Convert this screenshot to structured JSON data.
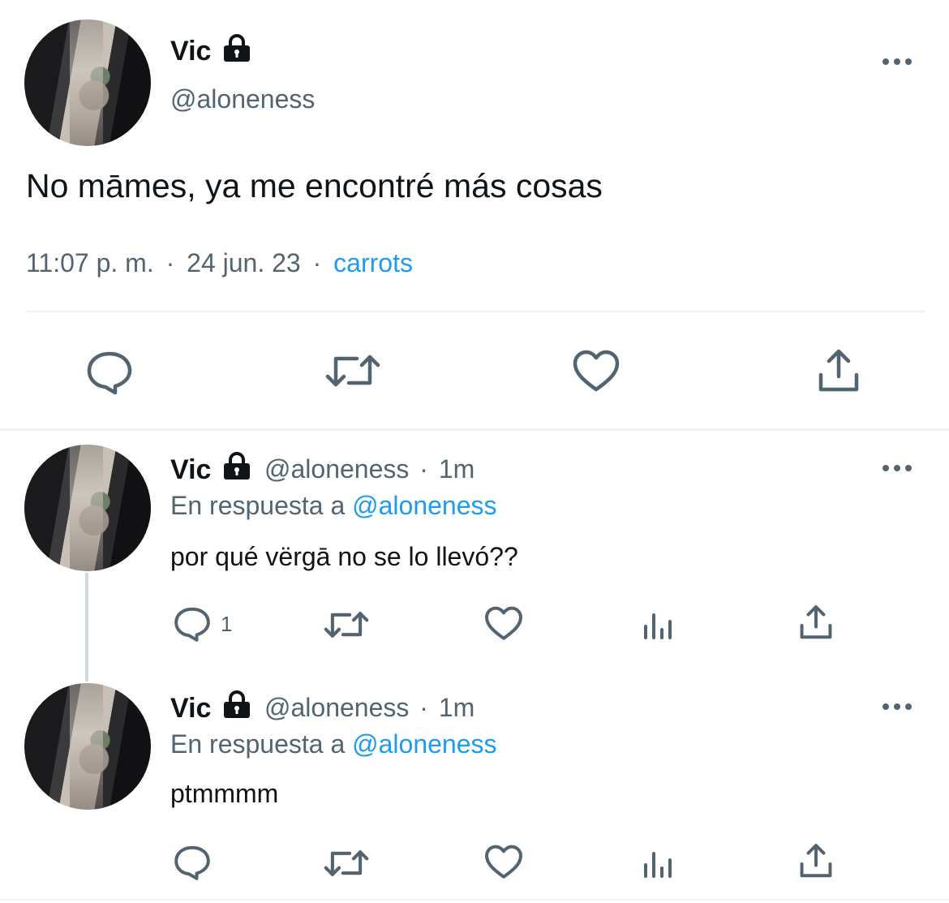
{
  "main_tweet": {
    "author_name": "Vic",
    "handle": "@aloneness",
    "text": "No māmes, ya me encontré más cosas",
    "time": "11:07 p. m.",
    "sep1": "·",
    "date": "24 jun. 23",
    "sep2": "·",
    "source": "carrots"
  },
  "replies": [
    {
      "author_name": "Vic",
      "handle": "@aloneness",
      "dot": "·",
      "time": "1m",
      "reply_prefix": "En respuesta a",
      "reply_to": "@aloneness",
      "text": "por qué vërgā no se lo llevó??",
      "reply_count": "1"
    },
    {
      "author_name": "Vic",
      "handle": "@aloneness",
      "dot": "·",
      "time": "1m",
      "reply_prefix": "En respuesta a",
      "reply_to": "@aloneness",
      "text": "ptmmmm",
      "reply_count": ""
    }
  ],
  "icons": [
    "comment-icon",
    "retweet-icon",
    "like-icon",
    "analytics-icon",
    "share-icon",
    "lock-icon",
    "more-icon"
  ],
  "colors": {
    "text": "#0f1419",
    "secondary": "#536471",
    "link": "#1d9bf0",
    "divider": "#eff3f4"
  }
}
